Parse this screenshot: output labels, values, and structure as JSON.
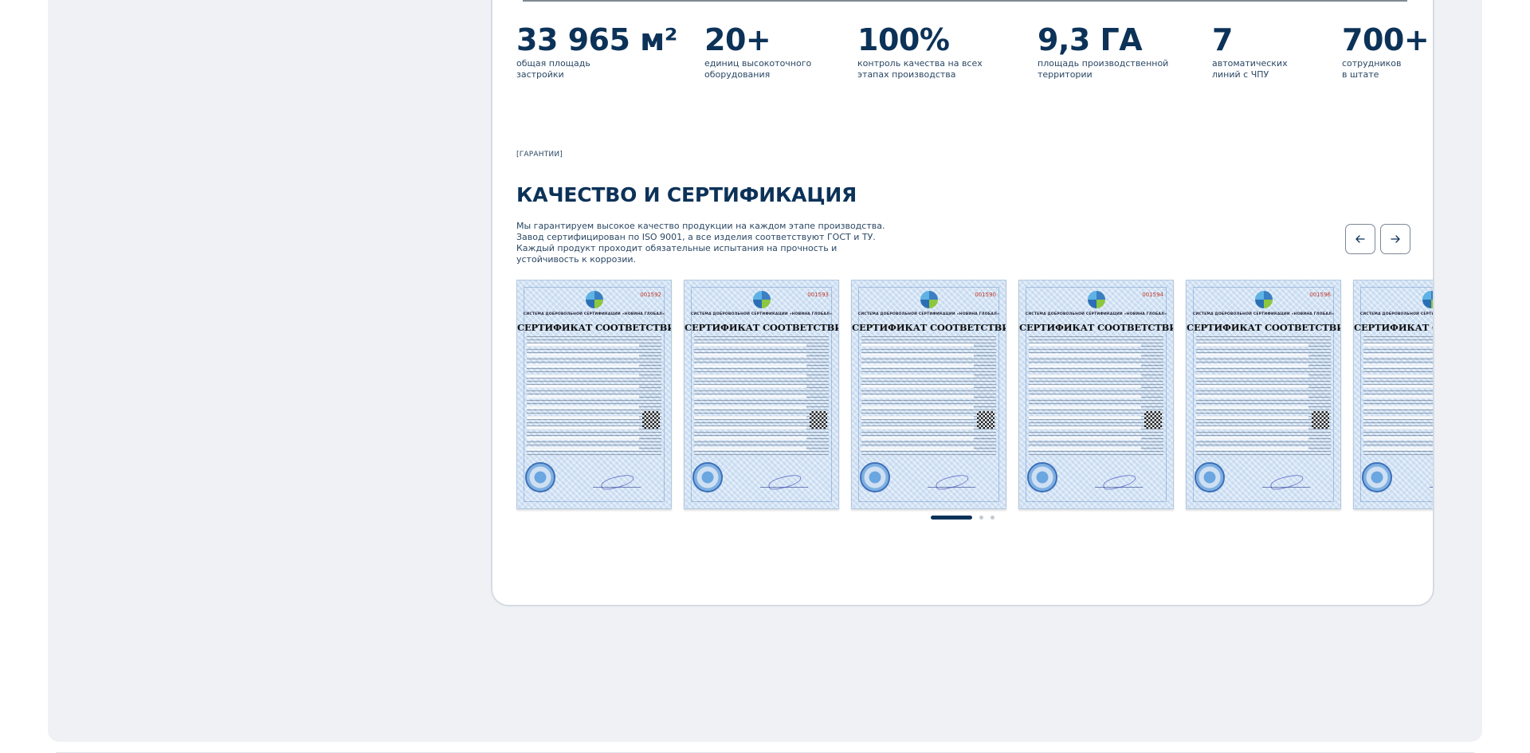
{
  "stats": [
    {
      "value": "33 965 м²",
      "label": "общая площадь\nзастройки"
    },
    {
      "value": "20+",
      "label": "единиц высокоточного\nоборудования"
    },
    {
      "value": "100%",
      "label": "контроль качества на всех\nэтапах производства"
    },
    {
      "value": "9,3 ГА",
      "label": "площадь производственной\nтерритории"
    },
    {
      "value": "7",
      "label": "автоматических\nлиний с ЧПУ"
    },
    {
      "value": "700+",
      "label": "сотрудников\nв штате"
    }
  ],
  "quality": {
    "eyebrow": "[ГАРАНТИИ]",
    "title": "КАЧЕСТВО И СЕРТИФИКАЦИЯ",
    "description": "Мы гарантируем высокое качество продукции на каждом этапе производства. Завод сертифицирован по ISO 9001, а все изделия соответствуют ГОСТ и ТУ. Каждый продукт проходит обязательные испытания на прочность и устойчивость к коррозии.",
    "prev_icon": "arrow-left-icon",
    "next_icon": "arrow-right-icon"
  },
  "certificates": [
    {
      "heading": "СЕРТИФИКАТ СООТВЕТСТВИЯ",
      "system": "СИСТЕМА ДОБРОВОЛЬНОЙ СЕРТИФИКАЦИИ «НОВИНА ГЛОБАЛ»",
      "number": "001592"
    },
    {
      "heading": "СЕРТИФИКАТ СООТВЕТСТВИЯ",
      "system": "СИСТЕМА ДОБРОВОЛЬНОЙ СЕРТИФИКАЦИИ «НОВИНА ГЛОБАЛ»",
      "number": "001593"
    },
    {
      "heading": "СЕРТИФИКАТ СООТВЕТСТВИЯ",
      "system": "СИСТЕМА ДОБРОВОЛЬНОЙ СЕРТИФИКАЦИИ «НОВИНА ГЛОБАЛ»",
      "number": "001590"
    },
    {
      "heading": "СЕРТИФИКАТ СООТВЕТСТВИЯ",
      "system": "СИСТЕМА ДОБРОВОЛЬНОЙ СЕРТИФИКАЦИИ «НОВИНА ГЛОБАЛ»",
      "number": "001594"
    },
    {
      "heading": "СЕРТИФИКАТ СООТВЕТСТВИЯ",
      "system": "СИСТЕМА ДОБРОВОЛЬНОЙ СЕРТИФИКАЦИИ «НОВИНА ГЛОБАЛ»",
      "number": "001596"
    },
    {
      "heading": "СЕРТИФИКАТ СООТВЕТСТВИЯ",
      "system": "СИСТЕМА ДОБРОВОЛЬНОЙ СЕРТИФИКАЦИИ «НОВИНА ГЛОБАЛ»",
      "number": ""
    }
  ],
  "pagination": {
    "count": 3,
    "active": 0
  },
  "colors": {
    "brand": "#0c3258",
    "text": "#2a4764",
    "page_bg": "#eff1f4",
    "accent_red": "#c0392b"
  }
}
